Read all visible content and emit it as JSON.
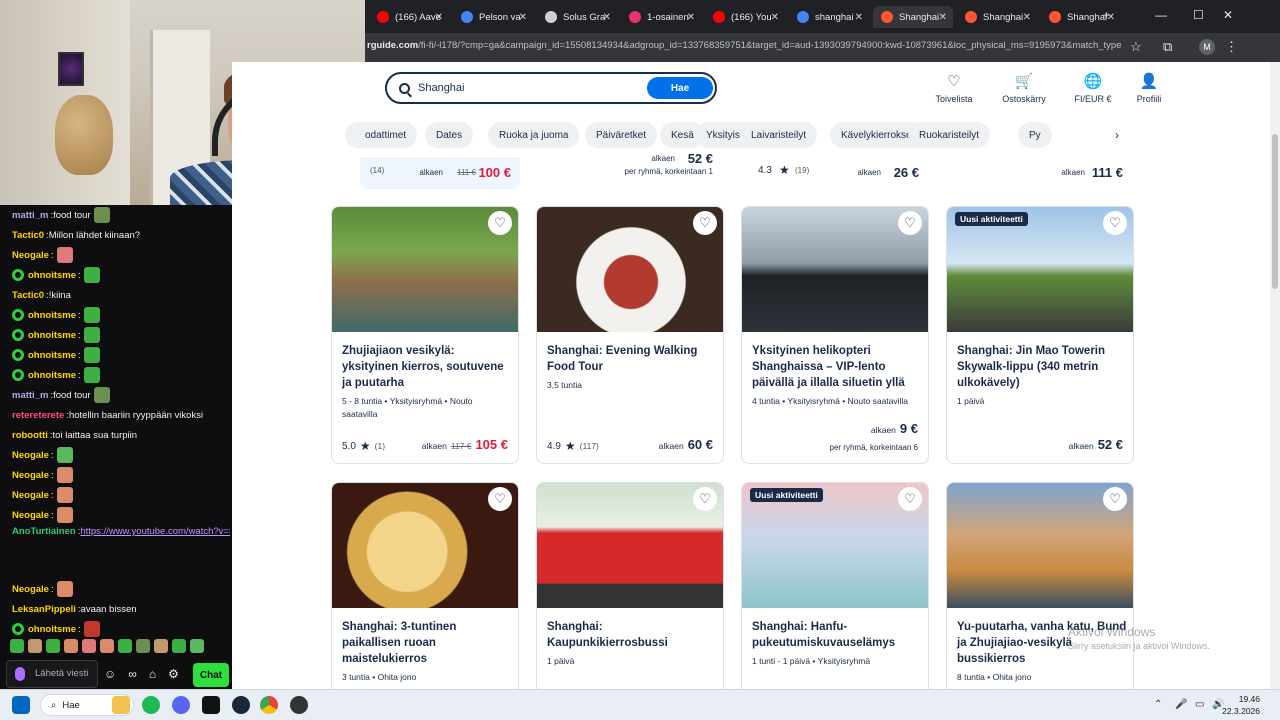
{
  "browser": {
    "tabs": [
      {
        "label": "(166) Aave",
        "color": "#ff0000"
      },
      {
        "label": "Pelson va",
        "color": "#4285f4"
      },
      {
        "label": "Solus Gra",
        "color": "#cfcfcf"
      },
      {
        "label": "1-osainen",
        "color": "#e8336d"
      },
      {
        "label": "(166) You",
        "color": "#ff0000"
      },
      {
        "label": "shanghai",
        "color": "#4285f4"
      },
      {
        "label": "Shanghai",
        "color": "#ff5533"
      },
      {
        "label": "Shanghai",
        "color": "#ff5533"
      },
      {
        "label": "Shanghai",
        "color": "#ff5533"
      }
    ],
    "url_host": "rguide.com",
    "url_rest": "/fi-fi/-l178/?cmp=ga&campaign_id=15508134934&adgroup_id=133768359751&target_id=aud-1393039794900:kwd-10873961&loc_physical_ms=9195973&match_type=...",
    "profile_initial": "M"
  },
  "site": {
    "search_value": "Shanghai",
    "search_button": "Hae",
    "nav": [
      {
        "label": "Toivelista",
        "icon": "heart-icon",
        "glyph": "♡"
      },
      {
        "label": "Ostoskärry",
        "icon": "cart-icon",
        "glyph": "🛒"
      },
      {
        "label": "FI/EUR €",
        "icon": "globe-icon",
        "glyph": "🌐"
      },
      {
        "label": "Profiili",
        "icon": "profile-icon",
        "glyph": "👤"
      }
    ],
    "chips": [
      "Nähtävyydet",
      "Dates",
      "Ruoka ja juoma",
      "Päiväretket",
      "Kesä",
      "Yksityiskierrokset",
      "Laivaristeilyt",
      "Kävelykierrokset",
      "Ruokaristeilyt",
      "Py"
    ],
    "chip_0_visible": "odattimet",
    "prev_row": [
      {
        "rating": "",
        "count": "(14)",
        "from": "alkaen",
        "old": "111 €",
        "price": "100 €",
        "red": true
      },
      {
        "rating": "",
        "count": "",
        "from": "alkaen",
        "old": "",
        "price": "52 €",
        "per": "per ryhmä, korkeintaan 1"
      },
      {
        "rating": "4.3",
        "count": "(19)",
        "from": "alkaen",
        "old": "",
        "price": "26 €"
      },
      {
        "rating": "",
        "count": "",
        "from": "alkaen",
        "old": "",
        "price": "111 €"
      }
    ],
    "cards": [
      {
        "title": "Zhujiajiaon vesikylä: yksityinen kierros, soutuvene ja puutarha",
        "meta": "5 - 8 tuntia • Yksityisryhmä • Nouto saatavilla",
        "rating": "5.0",
        "count": "(1)",
        "from": "alkaen",
        "old": "117 €",
        "price": "105 €",
        "red": true,
        "badge": "",
        "per": ""
      },
      {
        "title": "Shanghai: Evening Walking Food Tour",
        "meta": "3,5 tuntia",
        "rating": "4.9",
        "count": "(117)",
        "from": "alkaen",
        "old": "",
        "price": "60 €",
        "red": false,
        "badge": "",
        "per": ""
      },
      {
        "title": "Yksityinen helikopteri Shanghaissa – VIP-lento päivällä ja illalla siluetin yllä",
        "meta": "4 tuntia • Yksityisryhmä • Nouto saatavilla",
        "rating": "",
        "count": "",
        "from": "alkaen",
        "old": "",
        "price": "9 €",
        "red": false,
        "badge": "",
        "per": "per ryhmä, korkeintaan 6"
      },
      {
        "title": "Shanghai: Jin Mao Towerin Skywalk-lippu (340 metrin ulkokävely)",
        "meta": "1 päivä",
        "rating": "",
        "count": "",
        "from": "alkaen",
        "old": "",
        "price": "52 €",
        "red": false,
        "badge": "Uusi aktiviteetti",
        "per": ""
      },
      {
        "title": "Shanghai: 3-tuntinen paikallisen ruoan maistelukierros",
        "meta": "3 tuntia • Ohita jono",
        "badge": ""
      },
      {
        "title": "Shanghai: Kaupunkikierrosbussi",
        "meta": "1 päivä",
        "badge": ""
      },
      {
        "title": "Shanghai: Hanfu-pukeutumiskuvauselämys",
        "meta": "1 tunti - 1 päivä • Yksityisryhmä",
        "badge": "Uusi aktiviteetti"
      },
      {
        "title": "Yu-puutarha, vanha katu, Bund ja Zhujiajiao-vesikylä bussikierros",
        "meta": "8 tuntia • Ohita jono",
        "badge": ""
      }
    ]
  },
  "chat": {
    "lines": [
      {
        "user": "matti_m",
        "color": "#b9a3e3",
        "text": "food tour",
        "emote": "#6b8f4e"
      },
      {
        "user": "Tactic0",
        "color": "#ffd700",
        "text": "Millon lähdet kiinaan?"
      },
      {
        "user": "Neogale",
        "color": "#ffd700",
        "text": "",
        "emote": "#e07a7a"
      },
      {
        "user": "ohnoitsme",
        "color": "#ffd700",
        "text": "",
        "emote": "#3cb043",
        "badge": true
      },
      {
        "user": "Tactic0",
        "color": "#ffd700",
        "text": "!kiina"
      },
      {
        "user": "ohnoitsme",
        "color": "#ffd700",
        "text": "",
        "emote": "#3cb043",
        "badge": true
      },
      {
        "user": "ohnoitsme",
        "color": "#ffd700",
        "text": "",
        "emote": "#3cb043",
        "badge": true
      },
      {
        "user": "ohnoitsme",
        "color": "#ffd700",
        "text": "",
        "emote": "#3cb043",
        "badge": true
      },
      {
        "user": "ohnoitsme",
        "color": "#ffd700",
        "text": "",
        "emote": "#3cb043",
        "badge": true
      },
      {
        "user": "matti_m",
        "color": "#b9a3e3",
        "text": "food tour",
        "emote": "#6b8f4e"
      },
      {
        "user": "retereterete",
        "color": "#ff4f7b",
        "text": "hotellin baariin ryyppään vikoksi"
      },
      {
        "user": "robootti",
        "color": "#ffd700",
        "text": "toi laittaa sua turpiin"
      },
      {
        "user": "Neogale",
        "color": "#ffd700",
        "text": "",
        "emote": "#5cb85c"
      },
      {
        "user": "Neogale",
        "color": "#ffd700",
        "text": "",
        "emote": "#d98b6a"
      },
      {
        "user": "Neogale",
        "color": "#ffd700",
        "text": "",
        "emote": "#d98b6a"
      },
      {
        "user": "Neogale",
        "color": "#ffd700",
        "text": "",
        "emote": "#d98b6a"
      }
    ],
    "link_user": "AnoTurtiainen",
    "link_line1": "https://www.youtube.com/watch?",
    "link_line2": "v=FmTFk_UWBaE",
    "link_suffix": "ootko",
    "after_lines": [
      {
        "user": "Neogale",
        "color": "#ffd700",
        "text": "",
        "emote": "#d98b6a"
      },
      {
        "user": "LeksanPippeli",
        "color": "#ffd700",
        "text": "avaan bissen"
      },
      {
        "user": "ohnoitsme",
        "color": "#ffd700",
        "text": "",
        "emote": "#c0392b",
        "badge": true
      }
    ],
    "input_placeholder": "Lähetä viesti",
    "send_label": "Chat"
  },
  "watermark": {
    "title": "Aktivoi Windows",
    "sub": "Siirry asetuksiin ja aktivoi Windows."
  },
  "taskbar": {
    "search_label": "Hae",
    "time": "19.46",
    "date": "22.3.2026"
  }
}
